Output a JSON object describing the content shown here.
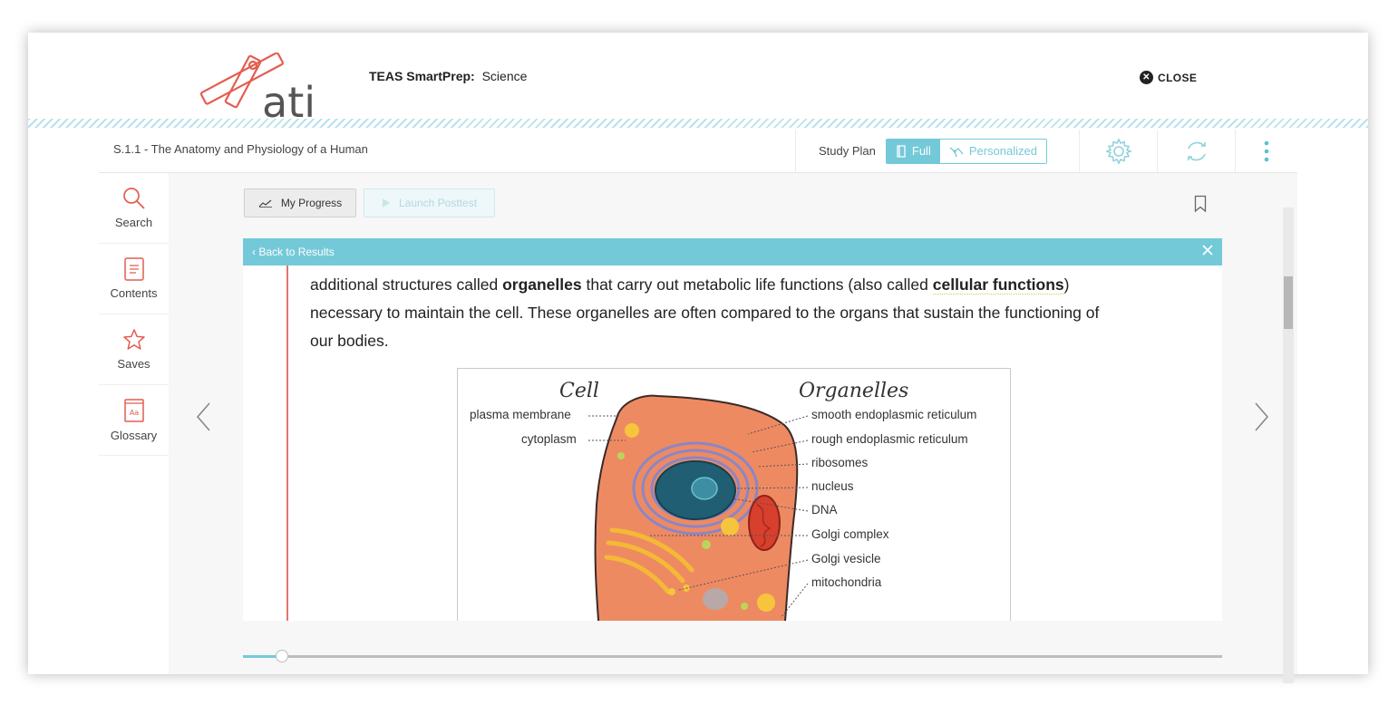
{
  "header": {
    "logo_text": "ati",
    "app_name": "TEAS SmartPrep:",
    "subject": "Science",
    "close_label": "CLOSE"
  },
  "topbar": {
    "breadcrumb": "S.1.1 - The Anatomy and Physiology of a Human",
    "study_plan_label": "Study Plan",
    "plan_options": [
      "Full",
      "Personalized"
    ],
    "selected_plan": "Full"
  },
  "sidebar": {
    "items": [
      {
        "label": "Search",
        "icon": "search-icon"
      },
      {
        "label": "Contents",
        "icon": "contents-icon"
      },
      {
        "label": "Saves",
        "icon": "star-icon"
      },
      {
        "label": "Glossary",
        "icon": "glossary-icon"
      }
    ],
    "glossary_icon_text": "Aa"
  },
  "toolbar": {
    "my_progress": "My Progress",
    "launch_posttest": "Launch Posttest"
  },
  "reader": {
    "back_link": "Back to Results",
    "text": {
      "p1": "additional structures called ",
      "t1": "organelles",
      "p2": " that carry out metabolic life functions (also called ",
      "t2": "cellular functions",
      "p3": ")",
      "line2": "necessary to maintain the cell. These organelles are often compared to the organs that sustain the functioning of",
      "line3": "our bodies."
    },
    "progress": 0.04
  },
  "figure": {
    "heading_left": "Cell",
    "heading_right": "Organelles",
    "labels_left": [
      "plasma membrane",
      "cytoplasm"
    ],
    "labels_right": [
      "smooth endoplasmic reticulum",
      "rough endoplasmic reticulum",
      "ribosomes",
      "nucleus",
      "DNA",
      "Golgi complex",
      "Golgi vesicle",
      "mitochondria"
    ]
  },
  "colors": {
    "accent": "#74c9d9",
    "brand_red": "#e0776c",
    "cell_body": "#ee8a62"
  }
}
